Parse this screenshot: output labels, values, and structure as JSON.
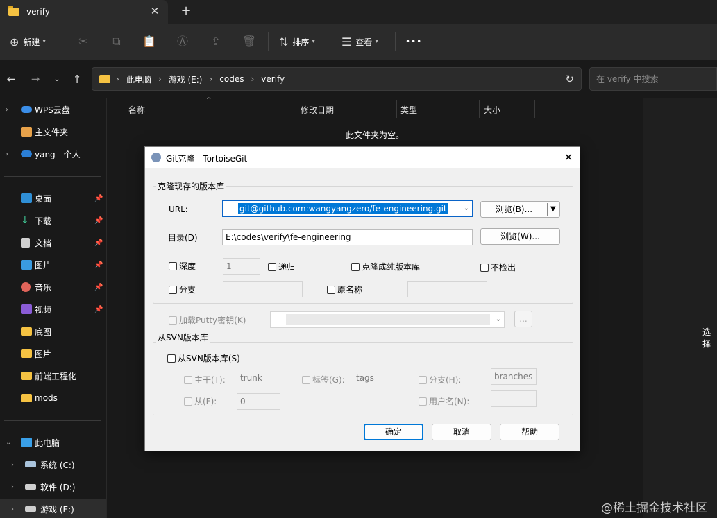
{
  "tab": {
    "title": "verify",
    "close": "✕",
    "new": "+"
  },
  "toolbar": {
    "new": "新建",
    "sort": "排序",
    "view": "查看",
    "more": "•••"
  },
  "address": {
    "crumbs": [
      "此电脑",
      "游戏 (E:)",
      "codes",
      "verify"
    ],
    "search_placeholder": "在 verify 中搜索"
  },
  "sidebar": {
    "items": [
      {
        "label": "WPS云盘"
      },
      {
        "label": "主文件夹"
      },
      {
        "label": "yang - 个人"
      },
      {
        "label": "桌面"
      },
      {
        "label": "下载"
      },
      {
        "label": "文档"
      },
      {
        "label": "图片"
      },
      {
        "label": "音乐"
      },
      {
        "label": "视频"
      },
      {
        "label": "底图"
      },
      {
        "label": "图片"
      },
      {
        "label": "前端工程化"
      },
      {
        "label": "mods"
      },
      {
        "label": "此电脑"
      },
      {
        "label": "系统 (C:)"
      },
      {
        "label": "软件 (D:)"
      },
      {
        "label": "游戏 (E:)"
      }
    ]
  },
  "filelist": {
    "columns": [
      "名称",
      "修改日期",
      "类型",
      "大小"
    ],
    "empty_message": "此文件夹为空。"
  },
  "preview": {
    "text": "选择"
  },
  "watermark": "@稀土掘金技术社区",
  "dialog": {
    "title": "Git克隆 - TortoiseGit",
    "close": "✕",
    "repo_group": "克隆现存的版本库",
    "url_label": "URL:",
    "url_value": "git@github.com:wangyangzero/fe-engineering.git",
    "browse_b": "浏览(B)...",
    "dir_label": "目录(D)",
    "dir_value": "E:\\codes\\verify\\fe-engineering",
    "browse_w": "浏览(W)...",
    "depth_label": "深度",
    "depth_value": "1",
    "recursive_label": "递归",
    "bare_label": "克隆成纯版本库",
    "no_checkout_label": "不检出",
    "branch_label": "分支",
    "origin_label": "原名称",
    "putty_label": "加载Putty密钥(K)",
    "putty_btn": "...",
    "svn_group": "从SVN版本库",
    "svn_check_label": "从SVN版本库(S)",
    "trunk_label": "主干(T):",
    "trunk_value": "trunk",
    "tags_label": "标签(G):",
    "tags_value": "tags",
    "branches_label": "分支(H):",
    "branches_value": "branches",
    "from_label": "从(F):",
    "from_value": "0",
    "username_label": "用户名(N):",
    "ok": "确定",
    "cancel": "取消",
    "help": "帮助"
  }
}
